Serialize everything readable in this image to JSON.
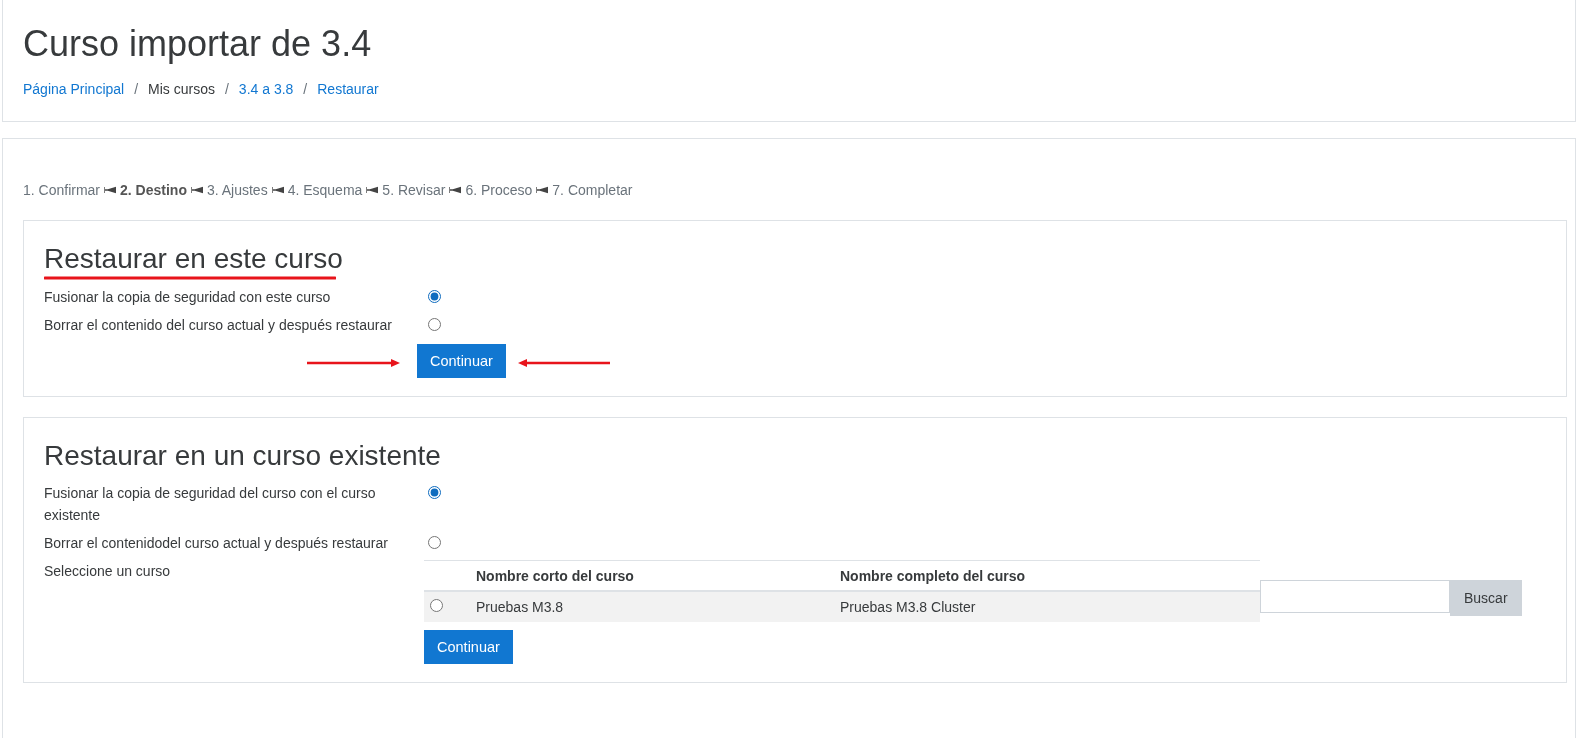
{
  "page_header": {
    "title": "Curso importar de 3.4",
    "breadcrumb_separator": "/",
    "breadcrumb": [
      {
        "label": "Página Principal",
        "link": true
      },
      {
        "label": "Mis cursos",
        "link": false
      },
      {
        "label": "3.4 a 3.8",
        "link": true
      },
      {
        "label": "Restaurar",
        "link": true
      }
    ]
  },
  "steps": [
    {
      "label": "1. Confirmar",
      "selected": false
    },
    {
      "label": "2. Destino",
      "selected": true
    },
    {
      "label": "3. Ajustes",
      "selected": false
    },
    {
      "label": "4. Esquema",
      "selected": false
    },
    {
      "label": "5. Revisar",
      "selected": false
    },
    {
      "label": "6. Proceso",
      "selected": false
    },
    {
      "label": "7. Completar",
      "selected": false
    }
  ],
  "sections": [
    {
      "title": "Restaurar en este curso",
      "annotated": true,
      "options": [
        {
          "label": "Fusionar la copia de seguridad con este curso",
          "selected": true
        },
        {
          "label": "Borrar el contenido del curso actual y después restaurar",
          "selected": false
        }
      ],
      "button": "Continuar"
    },
    {
      "title": "Restaurar en un curso existente",
      "annotated": false,
      "options": [
        {
          "label": "Fusionar la copia de seguridad del curso con el curso existente",
          "selected": true
        },
        {
          "label": "Borrar el contenidodel curso actual y después restaurar",
          "selected": false
        }
      ],
      "course_select": {
        "label": "Seleccione un curso",
        "columns": [
          "Nombre corto del curso",
          "Nombre completo del curso"
        ],
        "rows": [
          {
            "cells": [
              "Pruebas M3.8",
              "Pruebas M3.8 Cluster"
            ],
            "selected": false
          }
        ],
        "search_button": "Buscar"
      },
      "button": "Continuar"
    }
  ]
}
